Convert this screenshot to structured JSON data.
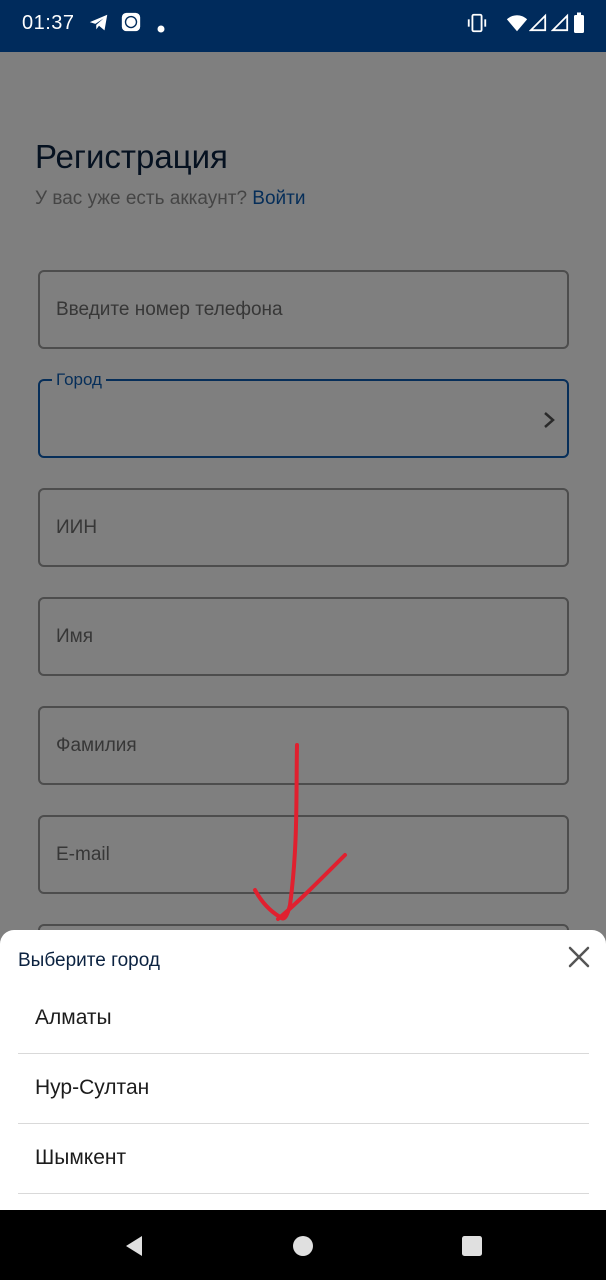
{
  "status_bar": {
    "time": "01:37",
    "icons": [
      "telegram-icon",
      "app-icon",
      "dot-icon",
      "vibrate-icon",
      "wifi-icon",
      "signal-icon",
      "signal-icon",
      "battery-icon"
    ]
  },
  "header": {
    "title": "Регистрация",
    "subtitle": "У вас уже есть аккаунт?",
    "login_link": "Войти"
  },
  "form": {
    "phone_placeholder": "Введите номер телефона",
    "city_label": "Город",
    "iin_placeholder": "ИИН",
    "first_name_placeholder": "Имя",
    "last_name_placeholder": "Фамилия",
    "email_placeholder": "E-mail"
  },
  "city_sheet": {
    "title": "Выберите город",
    "items": [
      {
        "label": "Алматы"
      },
      {
        "label": "Нур-Султан"
      },
      {
        "label": "Шымкент"
      }
    ]
  },
  "colors": {
    "status_bar": "#002b5c",
    "accent": "#0d5db3",
    "annotation": "#e0202f"
  }
}
